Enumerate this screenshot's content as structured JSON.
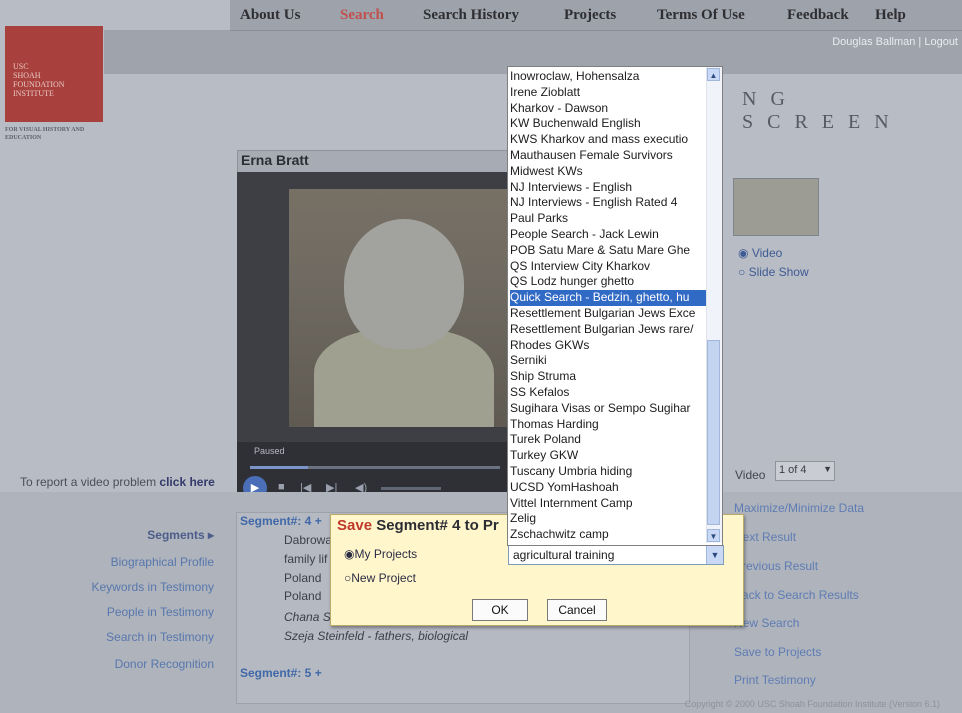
{
  "nav": {
    "items": [
      "About Us",
      "Search",
      "Search History",
      "Projects",
      "Terms Of Use",
      "Feedback",
      "Help"
    ],
    "active": "Search",
    "user_text": "Douglas Ballman | Logout"
  },
  "logo": {
    "lines": [
      "USC",
      "SHOAH",
      "FOUNDATION",
      "INSTITUTE"
    ],
    "subtitle": "FOR VISUAL HISTORY AND EDUCATION"
  },
  "screen_title": "NG SCREEN",
  "player": {
    "name": "Erna Bratt",
    "status": "Paused"
  },
  "report_link": {
    "prefix": "To report a video problem",
    "link": "click here"
  },
  "right_panel": {
    "radio_video": "Video",
    "radio_slideshow": "Slide Show",
    "video_label": "Video",
    "video_select_value": "1 of 4",
    "links": [
      "Maximize/Minimize Data",
      "Next Result",
      "Previous Result",
      "Back to Search Results",
      "New Search",
      "Save to Projects",
      "Print Testimony"
    ]
  },
  "left_nav": {
    "segments": "Segments",
    "items": [
      "Biographical Profile",
      "Keywords in Testimony",
      "People in Testimony",
      "Search in Testimony",
      "Donor Recognition"
    ]
  },
  "segment_panel": {
    "header": "Segment#: 4 +",
    "lines": [
      "Dabrowa",
      "family lif",
      "Poland",
      "Poland",
      "Chana S",
      "Szeja Steinfeld - fathers, biological"
    ],
    "next_header": "Segment#: 5 +"
  },
  "dialog": {
    "title_red": "Save",
    "title_rest": " Segment# 4 to Pr",
    "option_my": "My Projects",
    "option_new": "New Project",
    "selected_value": "agricultural training",
    "ok_label": "OK",
    "cancel_label": "Cancel"
  },
  "dropdown": {
    "items": [
      "Inowroclaw, Hohensalza",
      "Irene Zioblatt",
      "Kharkov - Dawson",
      "KW Buchenwald English",
      "KWS Kharkov and mass executio",
      "Mauthausen Female Survivors",
      "Midwest KWs",
      "NJ Interviews - English",
      "NJ Interviews - English Rated 4",
      "Paul Parks",
      "People Search - Jack Lewin",
      "POB Satu Mare & Satu Mare Ghe",
      "QS Interview City Kharkov",
      "QS Lodz hunger ghetto",
      "Quick Search - Bedzin, ghetto, hu",
      "Resettlement Bulgarian Jews Exce",
      "Resettlement Bulgarian Jews rare/",
      "Rhodes GKWs",
      "Serniki",
      "Ship Struma",
      "SS Kefalos",
      "Sugihara Visas or Sempo Sugihar",
      "Thomas Harding",
      "Turek Poland",
      "Turkey GKW",
      "Tuscany Umbria hiding",
      "UCSD YomHashoah",
      "Vittel Internment Camp",
      "Zelig",
      "Zschachwitz camp"
    ],
    "selected_index": 14
  },
  "copyright": "Copyright © 2000 USC Shoah Foundation Institute (Version 6.1)",
  "colors": {
    "accent_red": "#c0504d",
    "selection_blue": "#316ac5",
    "dialog_bg": "#fff6cc"
  }
}
